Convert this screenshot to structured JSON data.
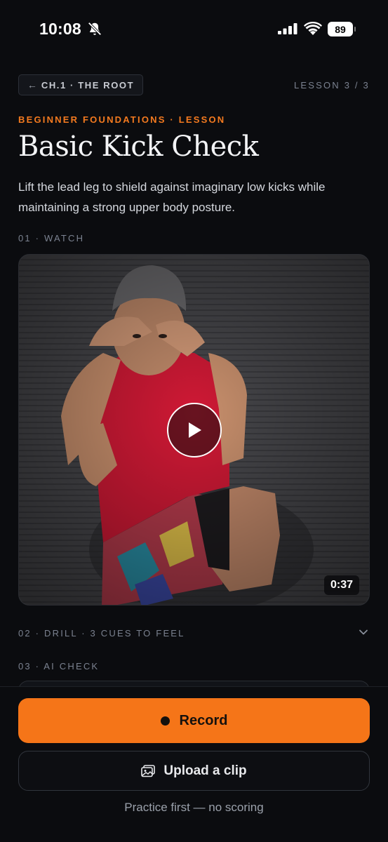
{
  "status_bar": {
    "time": "10:08",
    "battery": "89"
  },
  "header": {
    "back_label": "CH.1 · THE ROOT",
    "back_arrow": "←",
    "lesson_count": "LESSON 3 / 3"
  },
  "lesson": {
    "kicker": "BEGINNER FOUNDATIONS · LESSON",
    "title": "Basic Kick Check",
    "description": "Lift the lead leg to shield against imaginary low kicks while maintaining a strong upper body posture."
  },
  "sections": {
    "watch": "01 · WATCH",
    "drill": "02 · DRILL · 3 CUES TO FEEL",
    "ai_check": "03 · AI CHECK"
  },
  "video": {
    "duration": "0:37"
  },
  "actions": {
    "record_label": "Record",
    "upload_label": "Upload a clip",
    "practice_note": "Practice first — no scoring"
  },
  "colors": {
    "accent": "#f57518",
    "background": "#0b0c0f",
    "muted": "#7b8290"
  }
}
